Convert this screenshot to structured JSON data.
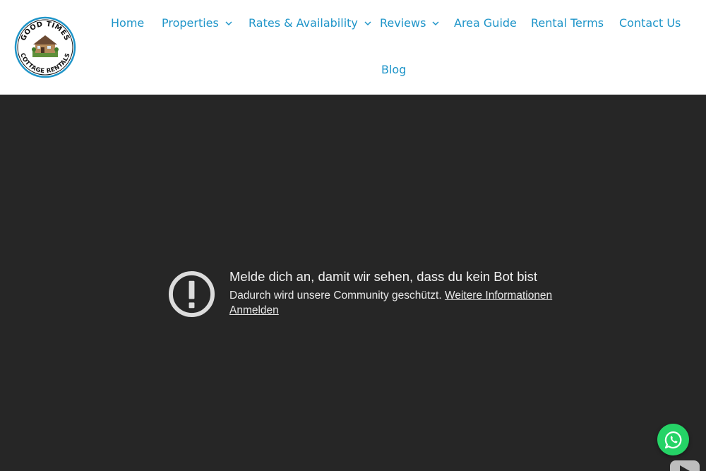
{
  "logo": {
    "top_text": "GOOD TIMES",
    "bottom_text": "COTTAGE RENTALS"
  },
  "nav": {
    "items": [
      {
        "label": "Home",
        "has_dropdown": false
      },
      {
        "label": "Properties",
        "has_dropdown": true
      },
      {
        "label": "Rates & Availability",
        "has_dropdown": true
      },
      {
        "label": "Reviews",
        "has_dropdown": true
      },
      {
        "label": "Area Guide",
        "has_dropdown": false
      },
      {
        "label": "Rental Terms",
        "has_dropdown": false
      },
      {
        "label": "Contact Us",
        "has_dropdown": false
      },
      {
        "label": "Blog",
        "has_dropdown": false
      }
    ]
  },
  "video": {
    "title": "Melde dich an, damit wir sehen, dass du kein Bot bist",
    "subtitle": "Dadurch wird unsere Community geschützt.",
    "more_info_link": "Weitere Informationen",
    "login_link": "Anmelden"
  },
  "icons": {
    "warning": "exclamation-circle-icon",
    "chat": "whatsapp-icon",
    "video_logo": "youtube-icon"
  },
  "colors": {
    "nav_link": "#1f95c9",
    "video_background": "#262626",
    "whatsapp_green": "#25d366"
  }
}
